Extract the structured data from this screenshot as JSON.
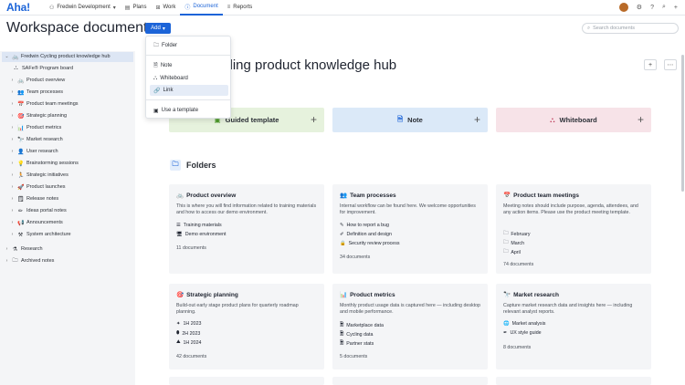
{
  "topbar": {
    "logo": "Aha!",
    "workspace": "Fredwin Development",
    "tabs": [
      {
        "label": "Plans",
        "icon": "plans-icon"
      },
      {
        "label": "Work",
        "icon": "work-icon"
      },
      {
        "label": "Document",
        "icon": "document-icon"
      },
      {
        "label": "Reports",
        "icon": "reports-icon"
      }
    ]
  },
  "header": {
    "title": "Workspace documents",
    "add_label": "Add",
    "search_placeholder": "Search documents"
  },
  "dropdown": {
    "items": [
      {
        "label": "Folder",
        "icon": "folder-icon"
      },
      {
        "label": "Note",
        "icon": "note-icon"
      },
      {
        "label": "Whiteboard",
        "icon": "whiteboard-icon"
      },
      {
        "label": "Link",
        "icon": "link-icon"
      },
      {
        "label": "Use a template",
        "icon": "template-icon"
      }
    ]
  },
  "sidebar": {
    "items": [
      {
        "label": "Fredwin Cycling product knowledge hub",
        "level": 0,
        "chev": "⌄"
      },
      {
        "label": "SAFe® Program board",
        "level": 1,
        "chev": ""
      },
      {
        "label": "Product overview",
        "level": 1,
        "chev": "›"
      },
      {
        "label": "Team processes",
        "level": 1,
        "chev": "›"
      },
      {
        "label": "Product team meetings",
        "level": 1,
        "chev": "›"
      },
      {
        "label": "Strategic planning",
        "level": 1,
        "chev": "›"
      },
      {
        "label": "Product metrics",
        "level": 1,
        "chev": "›"
      },
      {
        "label": "Market research",
        "level": 1,
        "chev": "›"
      },
      {
        "label": "User research",
        "level": 1,
        "chev": "›"
      },
      {
        "label": "Brainstorming sessions",
        "level": 1,
        "chev": "›"
      },
      {
        "label": "Strategic initiatives",
        "level": 1,
        "chev": "›"
      },
      {
        "label": "Product launches",
        "level": 1,
        "chev": "›"
      },
      {
        "label": "Release notes",
        "level": 1,
        "chev": "›"
      },
      {
        "label": "Ideas portal notes",
        "level": 1,
        "chev": "›"
      },
      {
        "label": "Announcements",
        "level": 1,
        "chev": "›"
      },
      {
        "label": "System architecture",
        "level": 1,
        "chev": "›"
      },
      {
        "label": "Research",
        "level": 0,
        "chev": "›"
      },
      {
        "label": "Archived notes",
        "level": 0,
        "chev": "›"
      }
    ]
  },
  "main": {
    "doc_title": "Fredwin Cycling product knowledge hub",
    "doc_title_visible": "cling product knowledge hub",
    "templates": [
      {
        "label": "Guided template",
        "visible": "Guided template",
        "color": "#e6f2dd"
      },
      {
        "label": "Note",
        "color": "#dbe9f8"
      },
      {
        "label": "Whiteboard",
        "color": "#f7e3e8"
      }
    ],
    "folders_heading": "Folders",
    "folders": [
      {
        "title": "Product overview",
        "desc": "This is where you will find information related to training materials and how to access our demo environment.",
        "links": [
          "Training materials",
          "Demo environment"
        ],
        "count": "11 documents"
      },
      {
        "title": "Team processes",
        "desc": "Internal workflow can be found here. We welcome opportunities for improvement.",
        "links": [
          "How to report a bug",
          "Definition and design",
          "Security review process"
        ],
        "count": "34 documents"
      },
      {
        "title": "Product team meetings",
        "desc": "Meeting notes should include purpose, agenda, attendees, and any action items. Please use the product meeting template.",
        "links": [
          "February",
          "March",
          "April"
        ],
        "count": "74 documents"
      },
      {
        "title": "Strategic planning",
        "desc": "Build-out early stage product plans for quarterly roadmap planning.",
        "links": [
          "1H 2023",
          "2H 2023",
          "1H 2024"
        ],
        "count": "42 documents"
      },
      {
        "title": "Product metrics",
        "desc": "Monthly product usage data is captured here — including desktop and mobile performance.",
        "links": [
          "Marketplace data",
          "Cycling data",
          "Partner stats"
        ],
        "count": "5 documents"
      },
      {
        "title": "Market research",
        "desc": "Capture market research data and insights here — including relevant analyst reports.",
        "links": [
          "Market analysis",
          "UX style guide"
        ],
        "count": "8 documents"
      }
    ]
  }
}
